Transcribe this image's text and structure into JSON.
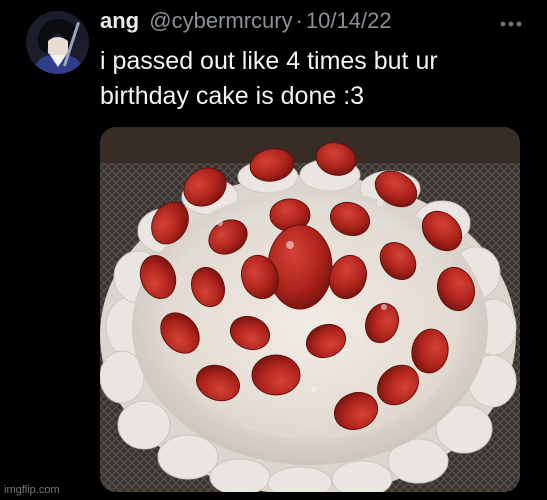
{
  "tweet": {
    "author": {
      "display_name": "ang",
      "handle": "@cybermrcury",
      "avatar_icon": "anime-character-avatar"
    },
    "separator": "·",
    "date": "10/14/22",
    "text_lines": [
      "i passed out like 4 times but ur",
      "birthday cake is done :3"
    ],
    "media": {
      "icon": "strawberry-cake-photo"
    },
    "more_icon": "more-dots-icon"
  },
  "watermark": "imgflip.com",
  "colors": {
    "background": "#000000",
    "text_primary": "#e7e9ea",
    "text_secondary": "#8b9096",
    "cake_frosting": "#f4f1ee",
    "strawberry": "#b8261e"
  }
}
